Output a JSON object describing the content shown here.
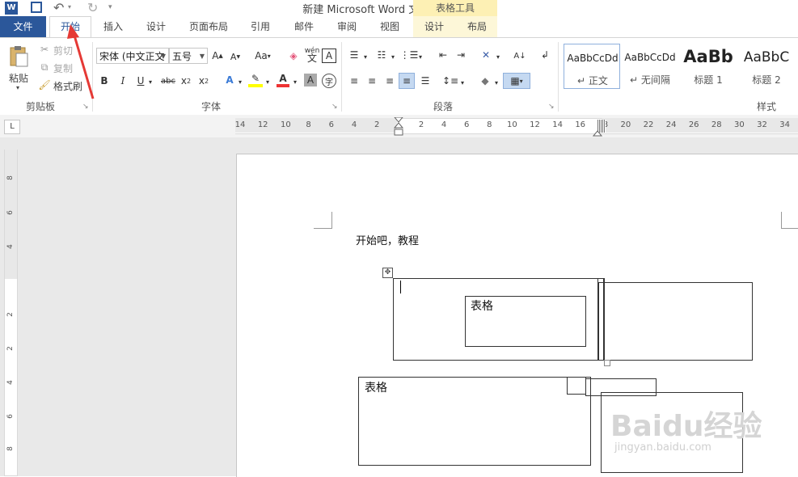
{
  "window": {
    "title": "新建 Microsoft Word 文档.docx - Word",
    "context_tab_group": "表格工具"
  },
  "tabs": [
    "文件",
    "开始",
    "插入",
    "设计",
    "页面布局",
    "引用",
    "邮件",
    "审阅",
    "视图",
    "设计",
    "布局"
  ],
  "ribbon": {
    "clipboard": {
      "paste": "粘贴",
      "cut": "剪切",
      "copy": "复制",
      "format_painter": "格式刷",
      "group": "剪贴板"
    },
    "font": {
      "font_name": "宋体 (中文正文",
      "font_size": "五号",
      "group": "字体",
      "aa_label": "Aa",
      "wen_label": "wén"
    },
    "paragraph": {
      "group": "段落"
    },
    "styles": {
      "group": "样式",
      "items": [
        {
          "sample": "AaBbCcDd",
          "name": "正文"
        },
        {
          "sample": "AaBbCcDd",
          "name": "无间隔"
        },
        {
          "sample": "AaBb",
          "name": "标题 1"
        },
        {
          "sample": "AaBbC",
          "name": "标题 2"
        }
      ]
    }
  },
  "ruler": {
    "h_left": [
      "14",
      "12",
      "10",
      "8",
      "6",
      "4",
      "2"
    ],
    "h_right": [
      "2",
      "4",
      "6",
      "8",
      "10",
      "12",
      "14",
      "16",
      "18",
      "20",
      "22",
      "24",
      "26",
      "28",
      "30",
      "32",
      "34"
    ],
    "v": [
      "8",
      "6",
      "4",
      "2",
      "2",
      "4",
      "6",
      "8",
      "10"
    ]
  },
  "document": {
    "paragraph": "开始吧，教程",
    "cell_text_1": "表格",
    "cell_text_2": "表格"
  },
  "watermark": {
    "logo": "Baidu经验",
    "url": "jingyan.baidu.com"
  },
  "colors": {
    "brand": "#2b579a",
    "arrow": "#e53935",
    "context": "#fdf0b4"
  }
}
